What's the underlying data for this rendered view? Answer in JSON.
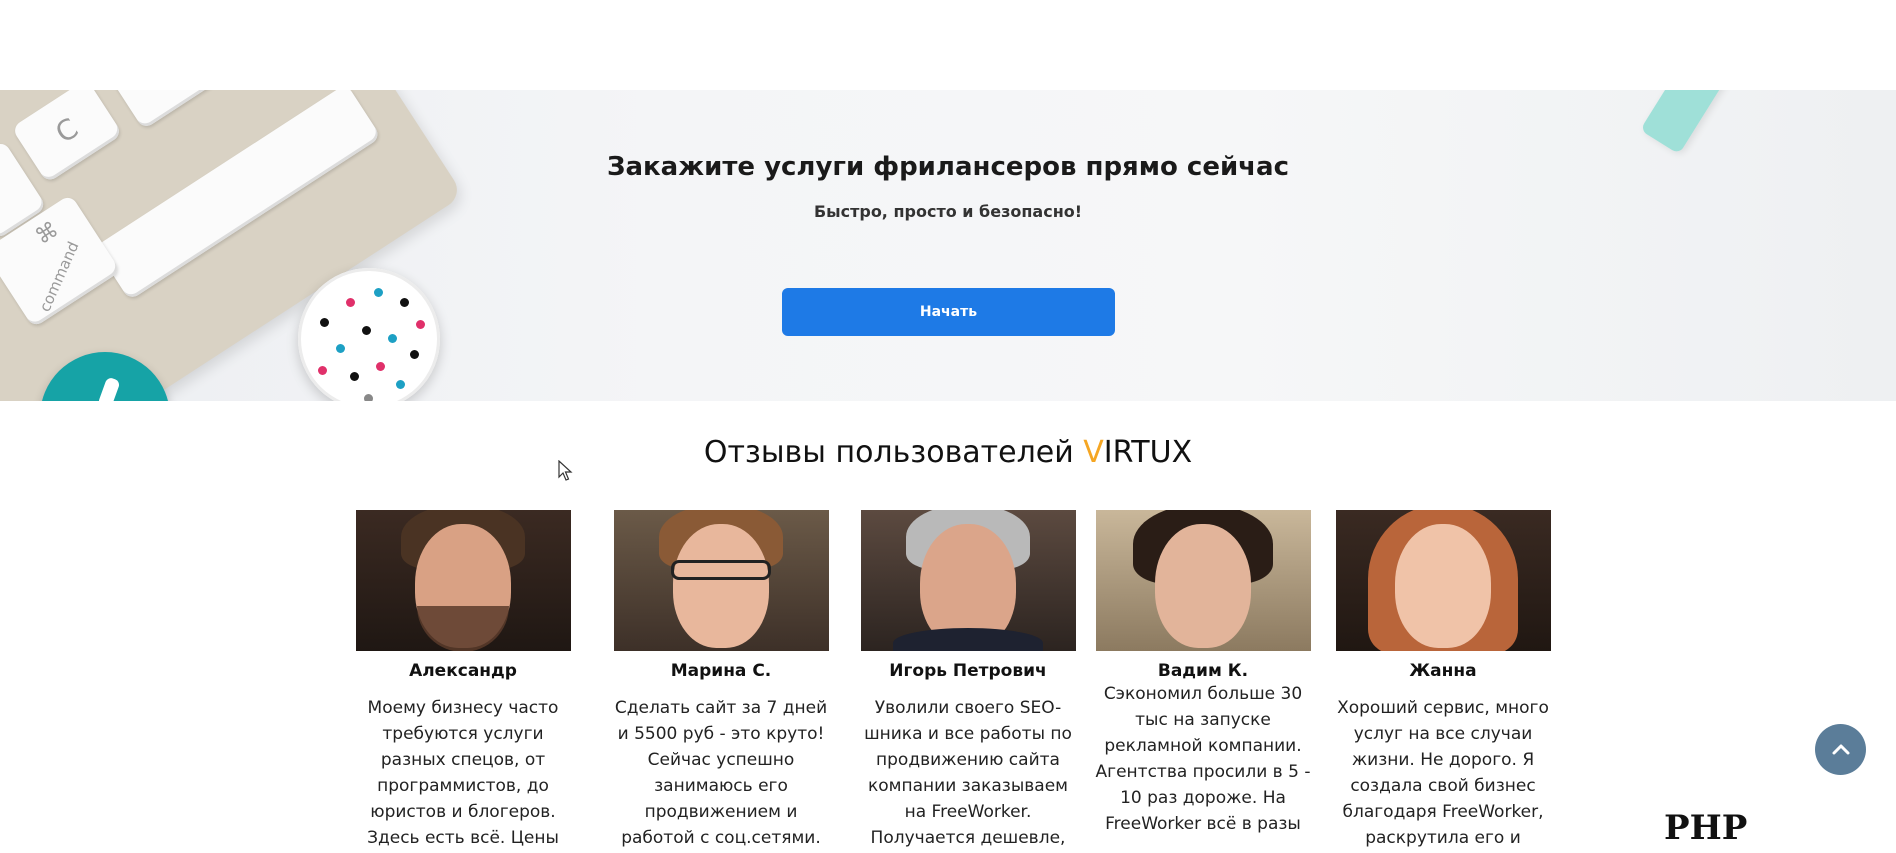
{
  "hero": {
    "title": "Закажите услуги фрилансеров прямо сейчас",
    "subtitle": "Быстро, просто и безопасно!",
    "cta_label": "Начать",
    "keyboard": {
      "key_c": "C",
      "cmd_symbol": "⌘",
      "cmd_label": "command"
    }
  },
  "reviews": {
    "title_prefix": "Отзывы пользователей ",
    "brand_accent": "V",
    "brand_rest": "IRTUX",
    "accent_color": "#f5a623",
    "items": [
      {
        "name": "Александр",
        "text": "Моему бизнесу часто требуются услуги разных спецов, от программистов, до юристов и блогеров. Здесь есть всё. Цены адекватные. Качество и"
      },
      {
        "name": "Марина С.",
        "text": "Сделать сайт за 7 дней и 5500 руб - это круто! Сейчас успешно занимаюсь его продвижением и работой с соц.сетями. Всё"
      },
      {
        "name": "Игорь Петрович",
        "text": "Уволили своего SEO-шника и все работы по продвижению сайта компании заказываем на FreeWorker. Получается дешевле, качественнее."
      },
      {
        "name": "Вадим К.",
        "text": "Сэкономил больше 30 тыс на запуске рекламной компании. Агентства просили в 5 - 10 раз дороже. На FreeWorker всё в разы"
      },
      {
        "name": "Жанна",
        "text": "Хороший сервис, много услуг на все случаи жизни. Не дорого. Я создала свой бизнес благодаря FreeWorker, раскрутила его и"
      }
    ]
  },
  "scroll_top_icon": "arrow-up-icon",
  "watermark": "PHP SRIPTS",
  "colors": {
    "primary_button": "#1e7ae6",
    "scroll_button": "#5b7d99"
  }
}
